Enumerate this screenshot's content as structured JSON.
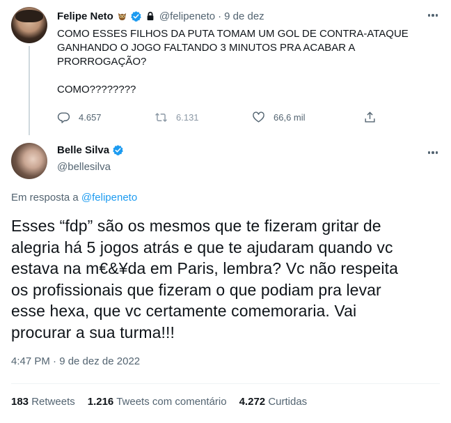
{
  "tweet1": {
    "name": "Felipe Neto",
    "handle": "@felipeneto",
    "separator": "·",
    "date": "9 de dez",
    "lines": [
      "COMO ESSES FILHOS DA PUTA TOMAM UM GOL DE CONTRA-ATAQUE",
      "GANHANDO O JOGO FALTANDO 3 MINUTOS PRA ACABAR A",
      "PRORROGAÇÃO?"
    ],
    "line_last": "COMO????????",
    "reply_count": "4.657",
    "retweet_count": "6.131",
    "like_count": "66,6 mil"
  },
  "tweet2": {
    "name": "Belle Silva",
    "handle": "@bellesilva",
    "reply_prefix": "Em resposta a",
    "reply_handle": "@felipeneto",
    "body_lines": [
      "Esses “fdp” são os mesmos que te fizeram gritar de",
      "alegria há 5 jogos atrás e que te ajudaram quando vc",
      "estava na m€&¥da em Paris, lembra? Vc não respeita",
      "os profissionais que fizeram o que podiam pra levar",
      "esse hexa, que vc certamente comemoraria. Vai",
      "procurar a sua turma!!!"
    ],
    "timestamp": "4:47 PM · 9 de dez de 2022",
    "retweets_value": "183",
    "retweets_label": "Retweets",
    "quotes_value": "1.216",
    "quotes_label": "Tweets com comentário",
    "likes_value": "4.272",
    "likes_label": "Curtidas"
  },
  "colors": {
    "text": "#0f1419",
    "secondary": "#536471",
    "link": "#1d9bf0",
    "verified": "#1d9bf0",
    "divider": "#eff3f4",
    "thread": "#cfd9de"
  },
  "icons": [
    "owl-icon",
    "verified-icon",
    "lock-icon",
    "more-icon",
    "reply-icon",
    "retweet-icon",
    "like-icon",
    "share-icon"
  ]
}
